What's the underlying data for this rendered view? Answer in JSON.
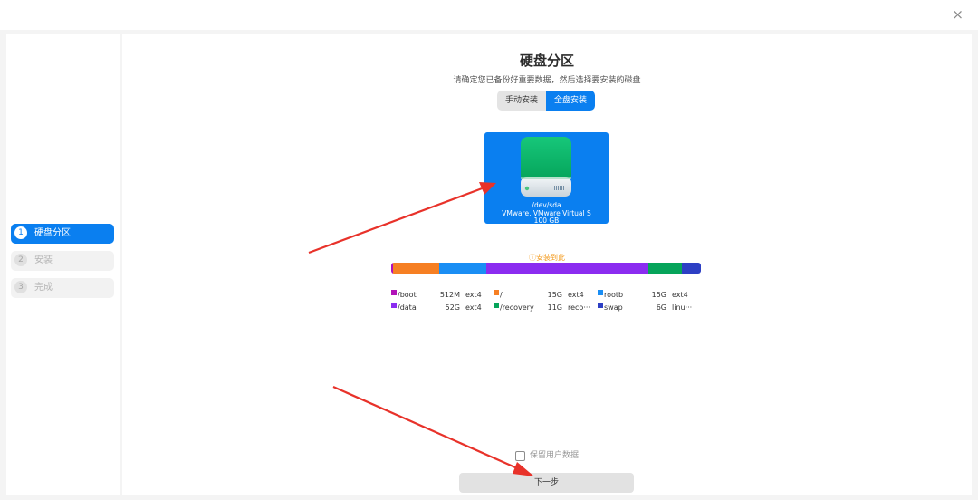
{
  "window": {
    "close_glyph": "×"
  },
  "sidebar": {
    "steps": [
      {
        "num": "1",
        "label": "硬盘分区",
        "active": true
      },
      {
        "num": "2",
        "label": "安装",
        "active": false
      },
      {
        "num": "3",
        "label": "完成",
        "active": false
      }
    ]
  },
  "main": {
    "title": "硬盘分区",
    "subtitle": "请确定您已备份好重要数据，然后选择要安装的磁盘",
    "tabs": {
      "manual": "手动安装",
      "full": "全盘安装",
      "selected": "full"
    },
    "disk": {
      "path": "/dev/sda",
      "model": "VMware, VMware Virtual S",
      "size": "100 GB",
      "icon": "hard-drive-icon"
    },
    "install_here": "ⓘ安装到此",
    "partitions": [
      {
        "name": "/boot",
        "size": "512M",
        "fs": "ext4",
        "color": "#b012b7",
        "share": 0.5
      },
      {
        "name": "/",
        "size": "15G",
        "fs": "ext4",
        "color": "#f67f23",
        "share": 15
      },
      {
        "name": "rootb",
        "size": "15G",
        "fs": "ext4",
        "color": "#1a8ef4",
        "share": 15
      },
      {
        "name": "/data",
        "size": "52G",
        "fs": "ext4",
        "color": "#8b2cf0",
        "share": 52
      },
      {
        "name": "/recovery",
        "size": "11G",
        "fs": "reco···",
        "color": "#06a45a",
        "share": 11
      },
      {
        "name": "swap",
        "size": "6G",
        "fs": "linu···",
        "color": "#2d3fc4",
        "share": 6
      }
    ],
    "keep_user_data": {
      "label": "保留用户数据",
      "checked": false
    },
    "next_button": "下一步"
  },
  "colors": {
    "accent": "#0a7ff0",
    "warning": "#f39a1c",
    "annotation_arrow": "#e8322a"
  }
}
